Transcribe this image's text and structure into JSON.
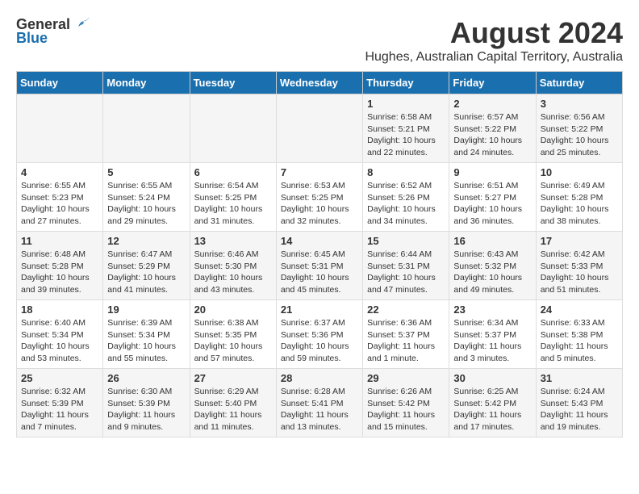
{
  "logo": {
    "general": "General",
    "blue": "Blue"
  },
  "title": "August 2024",
  "subtitle": "Hughes, Australian Capital Territory, Australia",
  "days_of_week": [
    "Sunday",
    "Monday",
    "Tuesday",
    "Wednesday",
    "Thursday",
    "Friday",
    "Saturday"
  ],
  "weeks": [
    [
      {
        "day": "",
        "info": ""
      },
      {
        "day": "",
        "info": ""
      },
      {
        "day": "",
        "info": ""
      },
      {
        "day": "",
        "info": ""
      },
      {
        "day": "1",
        "info": "Sunrise: 6:58 AM\nSunset: 5:21 PM\nDaylight: 10 hours\nand 22 minutes."
      },
      {
        "day": "2",
        "info": "Sunrise: 6:57 AM\nSunset: 5:22 PM\nDaylight: 10 hours\nand 24 minutes."
      },
      {
        "day": "3",
        "info": "Sunrise: 6:56 AM\nSunset: 5:22 PM\nDaylight: 10 hours\nand 25 minutes."
      }
    ],
    [
      {
        "day": "4",
        "info": "Sunrise: 6:55 AM\nSunset: 5:23 PM\nDaylight: 10 hours\nand 27 minutes."
      },
      {
        "day": "5",
        "info": "Sunrise: 6:55 AM\nSunset: 5:24 PM\nDaylight: 10 hours\nand 29 minutes."
      },
      {
        "day": "6",
        "info": "Sunrise: 6:54 AM\nSunset: 5:25 PM\nDaylight: 10 hours\nand 31 minutes."
      },
      {
        "day": "7",
        "info": "Sunrise: 6:53 AM\nSunset: 5:25 PM\nDaylight: 10 hours\nand 32 minutes."
      },
      {
        "day": "8",
        "info": "Sunrise: 6:52 AM\nSunset: 5:26 PM\nDaylight: 10 hours\nand 34 minutes."
      },
      {
        "day": "9",
        "info": "Sunrise: 6:51 AM\nSunset: 5:27 PM\nDaylight: 10 hours\nand 36 minutes."
      },
      {
        "day": "10",
        "info": "Sunrise: 6:49 AM\nSunset: 5:28 PM\nDaylight: 10 hours\nand 38 minutes."
      }
    ],
    [
      {
        "day": "11",
        "info": "Sunrise: 6:48 AM\nSunset: 5:28 PM\nDaylight: 10 hours\nand 39 minutes."
      },
      {
        "day": "12",
        "info": "Sunrise: 6:47 AM\nSunset: 5:29 PM\nDaylight: 10 hours\nand 41 minutes."
      },
      {
        "day": "13",
        "info": "Sunrise: 6:46 AM\nSunset: 5:30 PM\nDaylight: 10 hours\nand 43 minutes."
      },
      {
        "day": "14",
        "info": "Sunrise: 6:45 AM\nSunset: 5:31 PM\nDaylight: 10 hours\nand 45 minutes."
      },
      {
        "day": "15",
        "info": "Sunrise: 6:44 AM\nSunset: 5:31 PM\nDaylight: 10 hours\nand 47 minutes."
      },
      {
        "day": "16",
        "info": "Sunrise: 6:43 AM\nSunset: 5:32 PM\nDaylight: 10 hours\nand 49 minutes."
      },
      {
        "day": "17",
        "info": "Sunrise: 6:42 AM\nSunset: 5:33 PM\nDaylight: 10 hours\nand 51 minutes."
      }
    ],
    [
      {
        "day": "18",
        "info": "Sunrise: 6:40 AM\nSunset: 5:34 PM\nDaylight: 10 hours\nand 53 minutes."
      },
      {
        "day": "19",
        "info": "Sunrise: 6:39 AM\nSunset: 5:34 PM\nDaylight: 10 hours\nand 55 minutes."
      },
      {
        "day": "20",
        "info": "Sunrise: 6:38 AM\nSunset: 5:35 PM\nDaylight: 10 hours\nand 57 minutes."
      },
      {
        "day": "21",
        "info": "Sunrise: 6:37 AM\nSunset: 5:36 PM\nDaylight: 10 hours\nand 59 minutes."
      },
      {
        "day": "22",
        "info": "Sunrise: 6:36 AM\nSunset: 5:37 PM\nDaylight: 11 hours\nand 1 minute."
      },
      {
        "day": "23",
        "info": "Sunrise: 6:34 AM\nSunset: 5:37 PM\nDaylight: 11 hours\nand 3 minutes."
      },
      {
        "day": "24",
        "info": "Sunrise: 6:33 AM\nSunset: 5:38 PM\nDaylight: 11 hours\nand 5 minutes."
      }
    ],
    [
      {
        "day": "25",
        "info": "Sunrise: 6:32 AM\nSunset: 5:39 PM\nDaylight: 11 hours\nand 7 minutes."
      },
      {
        "day": "26",
        "info": "Sunrise: 6:30 AM\nSunset: 5:39 PM\nDaylight: 11 hours\nand 9 minutes."
      },
      {
        "day": "27",
        "info": "Sunrise: 6:29 AM\nSunset: 5:40 PM\nDaylight: 11 hours\nand 11 minutes."
      },
      {
        "day": "28",
        "info": "Sunrise: 6:28 AM\nSunset: 5:41 PM\nDaylight: 11 hours\nand 13 minutes."
      },
      {
        "day": "29",
        "info": "Sunrise: 6:26 AM\nSunset: 5:42 PM\nDaylight: 11 hours\nand 15 minutes."
      },
      {
        "day": "30",
        "info": "Sunrise: 6:25 AM\nSunset: 5:42 PM\nDaylight: 11 hours\nand 17 minutes."
      },
      {
        "day": "31",
        "info": "Sunrise: 6:24 AM\nSunset: 5:43 PM\nDaylight: 11 hours\nand 19 minutes."
      }
    ]
  ]
}
